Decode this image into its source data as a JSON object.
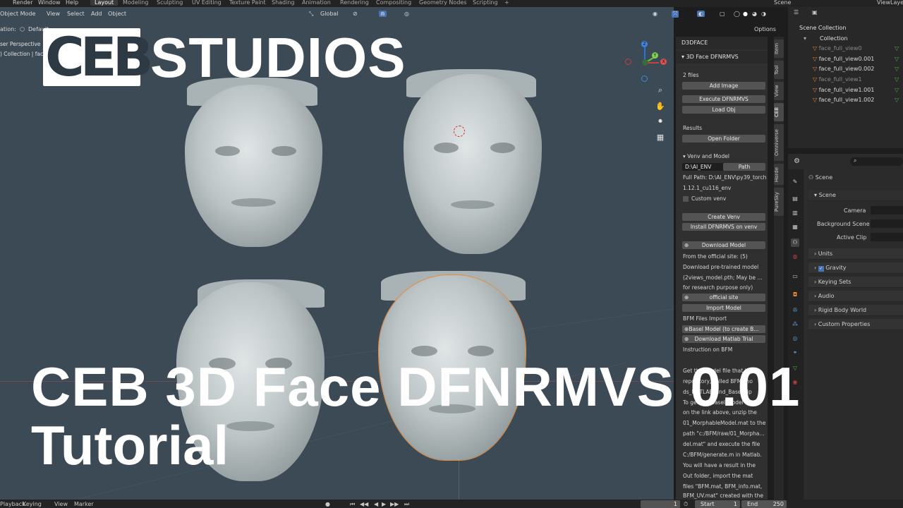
{
  "topbar": {
    "menus": [
      "Render",
      "Window",
      "Help"
    ],
    "workspaces": [
      "Layout",
      "Modeling",
      "Sculpting",
      "UV Editing",
      "Texture Paint",
      "Shading",
      "Animation",
      "Rendering",
      "Compositing",
      "Geometry Nodes",
      "Scripting"
    ],
    "active_workspace": "Layout",
    "add_tab": "+",
    "scene_label": "Scene",
    "viewlayer_label": "ViewLayer"
  },
  "viewport_header": {
    "mode": "Object Mode",
    "menus": [
      "View",
      "Select",
      "Add",
      "Object"
    ],
    "transform": "Global",
    "options": "Options",
    "orientation_prefix": "ation:",
    "orientation_value": "Default"
  },
  "viewport": {
    "perspective_label": "ser Perspective",
    "collection_label": ") Collection | face_full_view1.002",
    "axes": {
      "x": "X",
      "y": "Y",
      "z": "Z"
    }
  },
  "overlay": {
    "logo_left": "CEB",
    "logo_right": "STUDIOS",
    "title_line1": "CEB 3D Face DFNRMVS 0.01",
    "title_line2": "Tutorial"
  },
  "sidebar": {
    "panel_top": "D3DFACE",
    "panel_main": "3D Face DFNRMVS",
    "files_count": "2 files",
    "buttons": {
      "add_image": "Add Image",
      "execute": "Execute DFNRMVS",
      "load_obj": "Load Obj",
      "open_folder": "Open Folder",
      "create_venv": "Create Venv",
      "install": "Install DFNRMVS on venv",
      "download_model": "Download Model",
      "official_site": "official site",
      "import_model": "Import Model",
      "basel_model": "Basel Model (to create B...",
      "download_matlab": "Download Matlab Trial"
    },
    "results_label": "Results",
    "venv_header": "Venv and Model",
    "venv_path_value": "D:\\AI_ENV",
    "venv_path_btn": "Path",
    "full_path_1": "Full Path: D:\\AI_ENV\\py39_torch",
    "full_path_2": "1.12.1_cu116_env",
    "custom_venv": "Custom venv",
    "model_text": [
      "From the official site: (5)",
      "Download pre-trained model",
      "(2views_model.pth; May be ...",
      "for research purpose only)"
    ],
    "bfm_import": "BFM Files Import",
    "instruction": "Instruction on BFM",
    "instruction_text": [
      "Get the model file that is ca",
      "repository, called BFM_mo",
      "ds_MATLAB_and_Basel.zip",
      "To get the Basel model",
      "on the link above, unzip the",
      "01_MorphableModel.mat to the",
      "path \"c:/BFM/raw/01_Morpha...",
      "del.mat\" and execute the file",
      "C:/BFM/generate.m in Matlab.",
      "You will have a result in the",
      "Out folder, import the mat",
      "files \"BFM.mat, BFM_info.mat,",
      "BFM_UV.mat\" created with the"
    ],
    "tabs": [
      "Item",
      "Tool",
      "View",
      "CEB",
      "Omniverse",
      "Horde",
      "PureSky"
    ],
    "active_tab": "CEB"
  },
  "outliner": {
    "root": "Scene Collection",
    "collection": "Collection",
    "items": [
      {
        "name": "face_full_view0",
        "dim": true
      },
      {
        "name": "face_full_view0.001",
        "dim": false
      },
      {
        "name": "face_full_view0.002",
        "dim": false
      },
      {
        "name": "face_full_view1",
        "dim": true
      },
      {
        "name": "face_full_view1.001",
        "dim": false
      },
      {
        "name": "face_full_view1.002",
        "dim": false
      }
    ]
  },
  "properties": {
    "header": "Scene",
    "section": "Scene",
    "camera_label": "Camera",
    "background_label": "Background Scene",
    "active_clip_label": "Active Clip",
    "panels": [
      "Units",
      "Gravity",
      "Keying Sets",
      "Audio",
      "Rigid Body World",
      "Custom Properties"
    ]
  },
  "timeline": {
    "menus": [
      "Playback",
      "Keying",
      "View",
      "Marker"
    ],
    "current_frame": "1",
    "start_label": "Start",
    "start_value": "1",
    "end_label": "End",
    "end_value": "250"
  },
  "colors": {
    "viewport_bg": "#3c4a55",
    "panel_bg": "#303030",
    "button_bg": "#545454",
    "accent_blue": "#4772b3",
    "object_orange": "#e88a3a",
    "title_white": "#ffffff"
  }
}
